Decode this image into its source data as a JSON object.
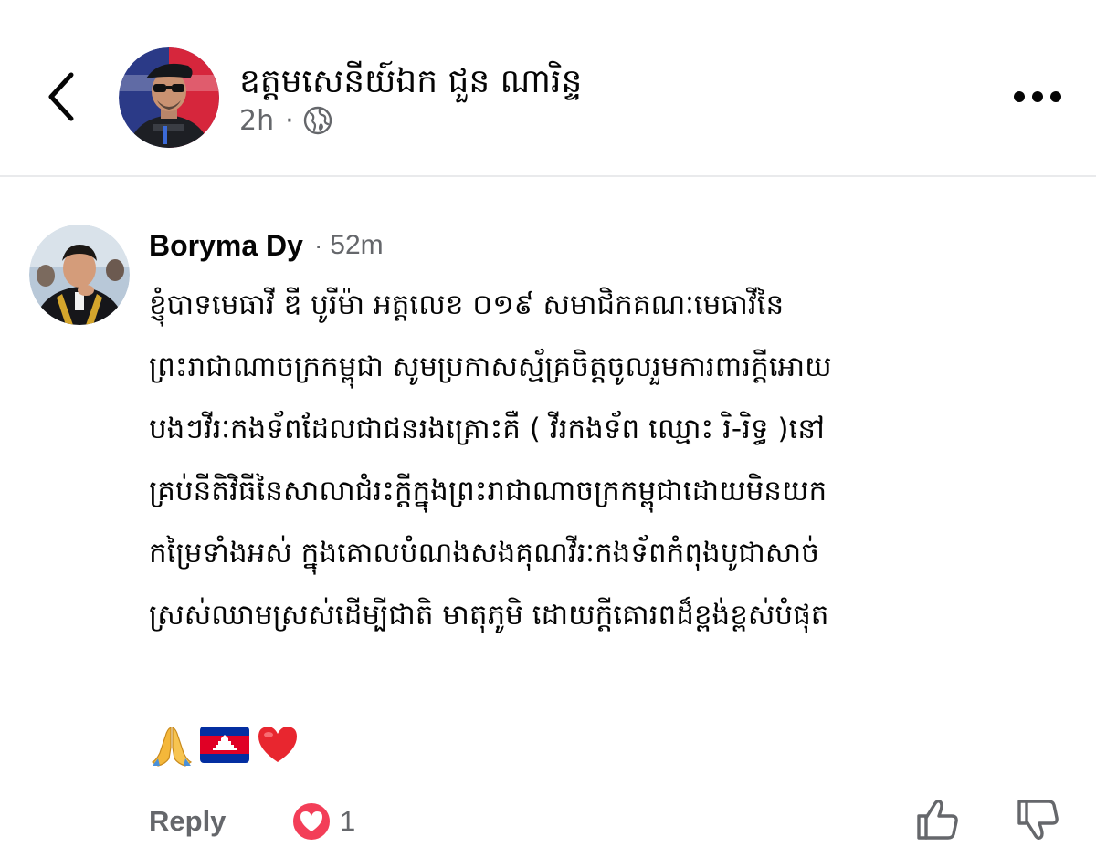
{
  "post": {
    "author": "ឧត្តមសេនីយ៍ឯក ជួន ណារិន្ទ",
    "time": "2h",
    "separator": "·",
    "audience_icon": "globe-icon"
  },
  "header": {
    "back_icon": "chevron-left-icon",
    "more_icon": "more-horizontal-icon"
  },
  "comment": {
    "author": "Boryma Dy",
    "separator": "·",
    "time": "52m",
    "text": "ខ្ញុំបាទមេធាវី ឌី បូរីម៉ា អត្តលេខ ០១៩ សមាជិកគណៈមេធាវីនៃ\nព្រះរាជាណាចក្រកម្ពុជា សូមប្រកាសស្ម័គ្រចិត្តចូលរួមការពារក្តីអោយ\nបងៗវីរៈកងទ័ពដែលជាជនរងគ្រោះគឺ ( វីរកងទ័ព ឈ្មោះ រិ-រិទ្ធ )នៅ\nគ្រប់នីតិវិធីនៃសាលាជំរះក្តីក្នុងព្រះរាជាណាចក្រកម្ពុជាដោយមិនយក\nកម្រៃទាំងអស់ ក្នុងគោលបំណងសងគុណវីរៈកងទ័ពកំពុងបូជាសាច់\nស្រស់ឈាមស្រស់ដើម្បីជាតិ មាតុភូមិ ដោយក្តីគោរពដ៏ខ្ពង់ខ្ពស់បំផុត",
    "emojis": [
      "folded-hands-emoji",
      "cambodia-flag-emoji",
      "red-heart-emoji"
    ],
    "actions": {
      "reply_label": "Reply",
      "reaction_count": "1",
      "reaction_icon": "love-reaction-icon",
      "like_icon": "thumbs-up-icon",
      "dislike_icon": "thumbs-down-icon"
    }
  },
  "colors": {
    "text_primary": "#050505",
    "text_secondary": "#65676b",
    "divider": "#e9eaec",
    "love_reaction": "#f33e58",
    "flag_blue": "#032ea1",
    "flag_red": "#e00025"
  }
}
